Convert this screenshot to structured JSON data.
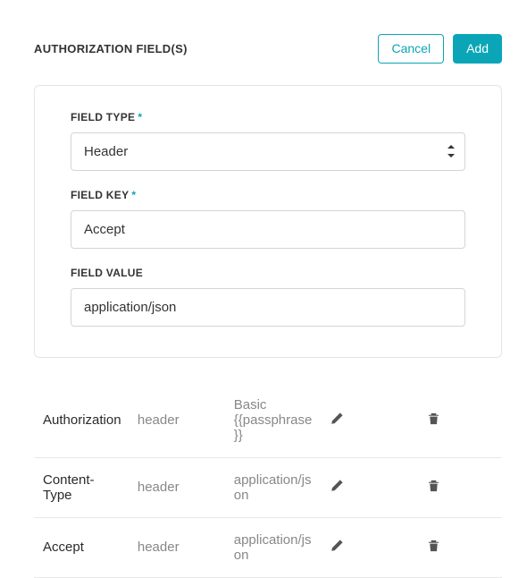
{
  "header": {
    "title": "AUTHORIZATION FIELD(S)",
    "cancel": "Cancel",
    "add": "Add"
  },
  "form": {
    "field_type_label": "FIELD TYPE",
    "field_type_value": "Header",
    "field_key_label": "FIELD KEY",
    "field_key_value": "Accept",
    "field_value_label": "FIELD VALUE",
    "field_value_value": "application/json",
    "required": "*"
  },
  "rows": [
    {
      "key": "Authorization",
      "type": "header",
      "value": "Basic {{passphrase}}"
    },
    {
      "key": "Content-Type",
      "type": "header",
      "value": "application/json"
    },
    {
      "key": "Accept",
      "type": "header",
      "value": "application/json"
    }
  ]
}
